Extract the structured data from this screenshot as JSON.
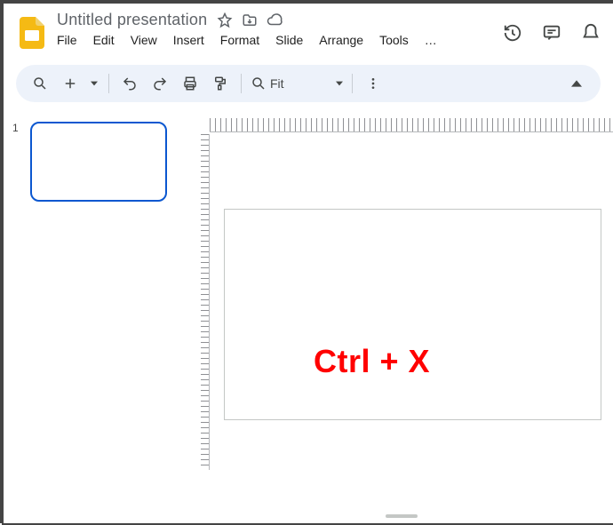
{
  "doc": {
    "title": "Untitled presentation"
  },
  "menu": [
    "File",
    "Edit",
    "View",
    "Insert",
    "Format",
    "Slide",
    "Arrange",
    "Tools",
    "…"
  ],
  "toolbar": {
    "zoom_label": "Fit"
  },
  "slides": [
    {
      "number": "1"
    }
  ],
  "overlay": {
    "text": "Ctrl + X"
  }
}
